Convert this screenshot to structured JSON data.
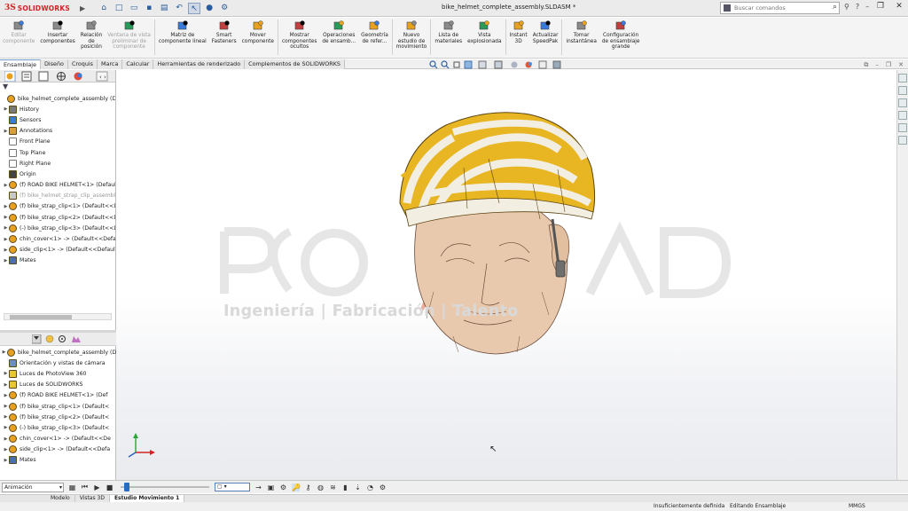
{
  "app": {
    "logo_ds": "3S",
    "logo_name": "SOLIDWORKS",
    "document_title": "bike_helmet_complete_assembly.SLDASM *",
    "search_placeholder": "Buscar comandos"
  },
  "command_manager": [
    {
      "label": "Editar\ncomponente",
      "icon": "edit-component-icon",
      "disabled": true
    },
    {
      "label": "Insertar\ncomponentes",
      "icon": "insert-components-icon",
      "disabled": false
    },
    {
      "label": "Relación\nde\nposición",
      "icon": "mate-icon",
      "disabled": false
    },
    {
      "label": "Ventana de vista\npreliminar de\ncomponente",
      "icon": "preview-window-icon",
      "disabled": true
    },
    {
      "label": "Matriz de\ncomponente lineal",
      "icon": "linear-pattern-icon",
      "disabled": false
    },
    {
      "label": "Smart\nFasteners",
      "icon": "smart-fasteners-icon",
      "disabled": false
    },
    {
      "label": "Mover\ncomponente",
      "icon": "move-component-icon",
      "disabled": false
    },
    {
      "label": "Mostrar\ncomponentes\nocultos",
      "icon": "show-hidden-icon",
      "disabled": false
    },
    {
      "label": "Operaciones\nde ensamb...",
      "icon": "assembly-features-icon",
      "disabled": false
    },
    {
      "label": "Geometría\nde refer...",
      "icon": "reference-geometry-icon",
      "disabled": false
    },
    {
      "label": "Nuevo\nestudio de\nmovimiento",
      "icon": "motion-study-icon",
      "disabled": false
    },
    {
      "label": "Lista de\nmateriales",
      "icon": "bom-icon",
      "disabled": false
    },
    {
      "label": "Vista\nexplosionada",
      "icon": "exploded-view-icon",
      "disabled": false
    },
    {
      "label": "Instant\n3D",
      "icon": "instant3d-icon",
      "disabled": false
    },
    {
      "label": "Actualizar\nSpeedPak",
      "icon": "speedpak-icon",
      "disabled": false
    },
    {
      "label": "Tomar\ninstantánea",
      "icon": "snapshot-icon",
      "disabled": false
    },
    {
      "label": "Configuración\nde ensamblaje\ngrande",
      "icon": "large-assembly-icon",
      "disabled": false
    }
  ],
  "tabs": [
    "Ensamblaje",
    "Diseño",
    "Croquis",
    "Marca",
    "Calcular",
    "Herramientas de renderizado",
    "Complementos de SOLIDWORKS"
  ],
  "active_tab": "Ensamblaje",
  "feature_tree": [
    {
      "label": "bike_helmet_complete_assembly  (Defau",
      "icon": "assembly-icon",
      "indent": 0,
      "expand": false,
      "dim": false
    },
    {
      "label": "History",
      "icon": "history-icon",
      "indent": 1,
      "expand": true,
      "dim": false
    },
    {
      "label": "Sensors",
      "icon": "sensor-icon",
      "indent": 1,
      "expand": false,
      "dim": false
    },
    {
      "label": "Annotations",
      "icon": "annotation-icon",
      "indent": 1,
      "expand": true,
      "dim": false
    },
    {
      "label": "Front Plane",
      "icon": "plane-icon",
      "indent": 1,
      "expand": false,
      "dim": false
    },
    {
      "label": "Top Plane",
      "icon": "plane-icon",
      "indent": 1,
      "expand": false,
      "dim": false
    },
    {
      "label": "Right Plane",
      "icon": "plane-icon",
      "indent": 1,
      "expand": false,
      "dim": false
    },
    {
      "label": "Origin",
      "icon": "origin-icon",
      "indent": 1,
      "expand": false,
      "dim": false
    },
    {
      "label": "(f) ROAD BIKE HELMET<1> (Default<",
      "icon": "part-icon",
      "indent": 1,
      "expand": true,
      "dim": false
    },
    {
      "label": "(f) bike_helmet_strap_clip_assembly<",
      "icon": "subassembly-icon",
      "indent": 1,
      "expand": false,
      "dim": true
    },
    {
      "label": "(f) bike_strap_clip<1> (Default<<Def",
      "icon": "part-icon",
      "indent": 1,
      "expand": true,
      "dim": false
    },
    {
      "label": "(f) bike_strap_clip<2> (Default<<Def",
      "icon": "part-icon",
      "indent": 1,
      "expand": true,
      "dim": false
    },
    {
      "label": "(-) bike_strap_clip<3> (Default<<Def",
      "icon": "part-icon",
      "indent": 1,
      "expand": true,
      "dim": false
    },
    {
      "label": "chin_cover<1> -> (Default<<Default",
      "icon": "part-icon",
      "indent": 1,
      "expand": true,
      "dim": false
    },
    {
      "label": "side_clip<1> -> (Default<<Default>",
      "icon": "part-icon",
      "indent": 1,
      "expand": true,
      "dim": false
    },
    {
      "label": "Mates",
      "icon": "mates-icon",
      "indent": 1,
      "expand": true,
      "dim": false
    }
  ],
  "motion_tree": [
    {
      "label": "bike_helmet_complete_assembly  (De",
      "icon": "assembly-icon",
      "indent": 0,
      "expand": true
    },
    {
      "label": "Orientación y vistas de cámara",
      "icon": "camera-icon",
      "indent": 1,
      "expand": false
    },
    {
      "label": "Luces de PhotoView 360",
      "icon": "lights-icon",
      "indent": 1,
      "expand": true
    },
    {
      "label": "Luces de SOLIDWORKS",
      "icon": "lights-icon",
      "indent": 1,
      "expand": true
    },
    {
      "label": "(f) ROAD BIKE HELMET<1> (Def",
      "icon": "part-icon",
      "indent": 1,
      "expand": true
    },
    {
      "label": "(f) bike_strap_clip<1> (Default<",
      "icon": "part-icon",
      "indent": 1,
      "expand": true
    },
    {
      "label": "(f) bike_strap_clip<2> (Default<",
      "icon": "part-icon",
      "indent": 1,
      "expand": true
    },
    {
      "label": "(-) bike_strap_clip<3> (Default<",
      "icon": "part-icon",
      "indent": 1,
      "expand": true
    },
    {
      "label": "chin_cover<1> -> (Default<<De",
      "icon": "part-icon",
      "indent": 1,
      "expand": true
    },
    {
      "label": "side_clip<1> -> (Default<<Defa",
      "icon": "part-icon",
      "indent": 1,
      "expand": true
    },
    {
      "label": "Mates",
      "icon": "mates-icon",
      "indent": 1,
      "expand": true
    }
  ],
  "viewport": {
    "watermark_subtitle": "Ingeniería | Fabricación | Talento"
  },
  "motion_bar": {
    "study_type": "Animación"
  },
  "bottom_tabs": [
    "Modelo",
    "Vistas 3D",
    "Estudio Movimiento 1"
  ],
  "active_bottom_tab": "Estudio Movimiento 1",
  "status": {
    "definition": "Insuficientemente definida",
    "mode": "Editando Ensamblaje",
    "units": "MMGS"
  },
  "colors": {
    "brand_red": "#d32226",
    "helmet_yellow": "#e8b623",
    "helmet_shell": "#f3eee2",
    "head_skin": "#e9c9ad",
    "accent_blue": "#2a6cc4"
  }
}
